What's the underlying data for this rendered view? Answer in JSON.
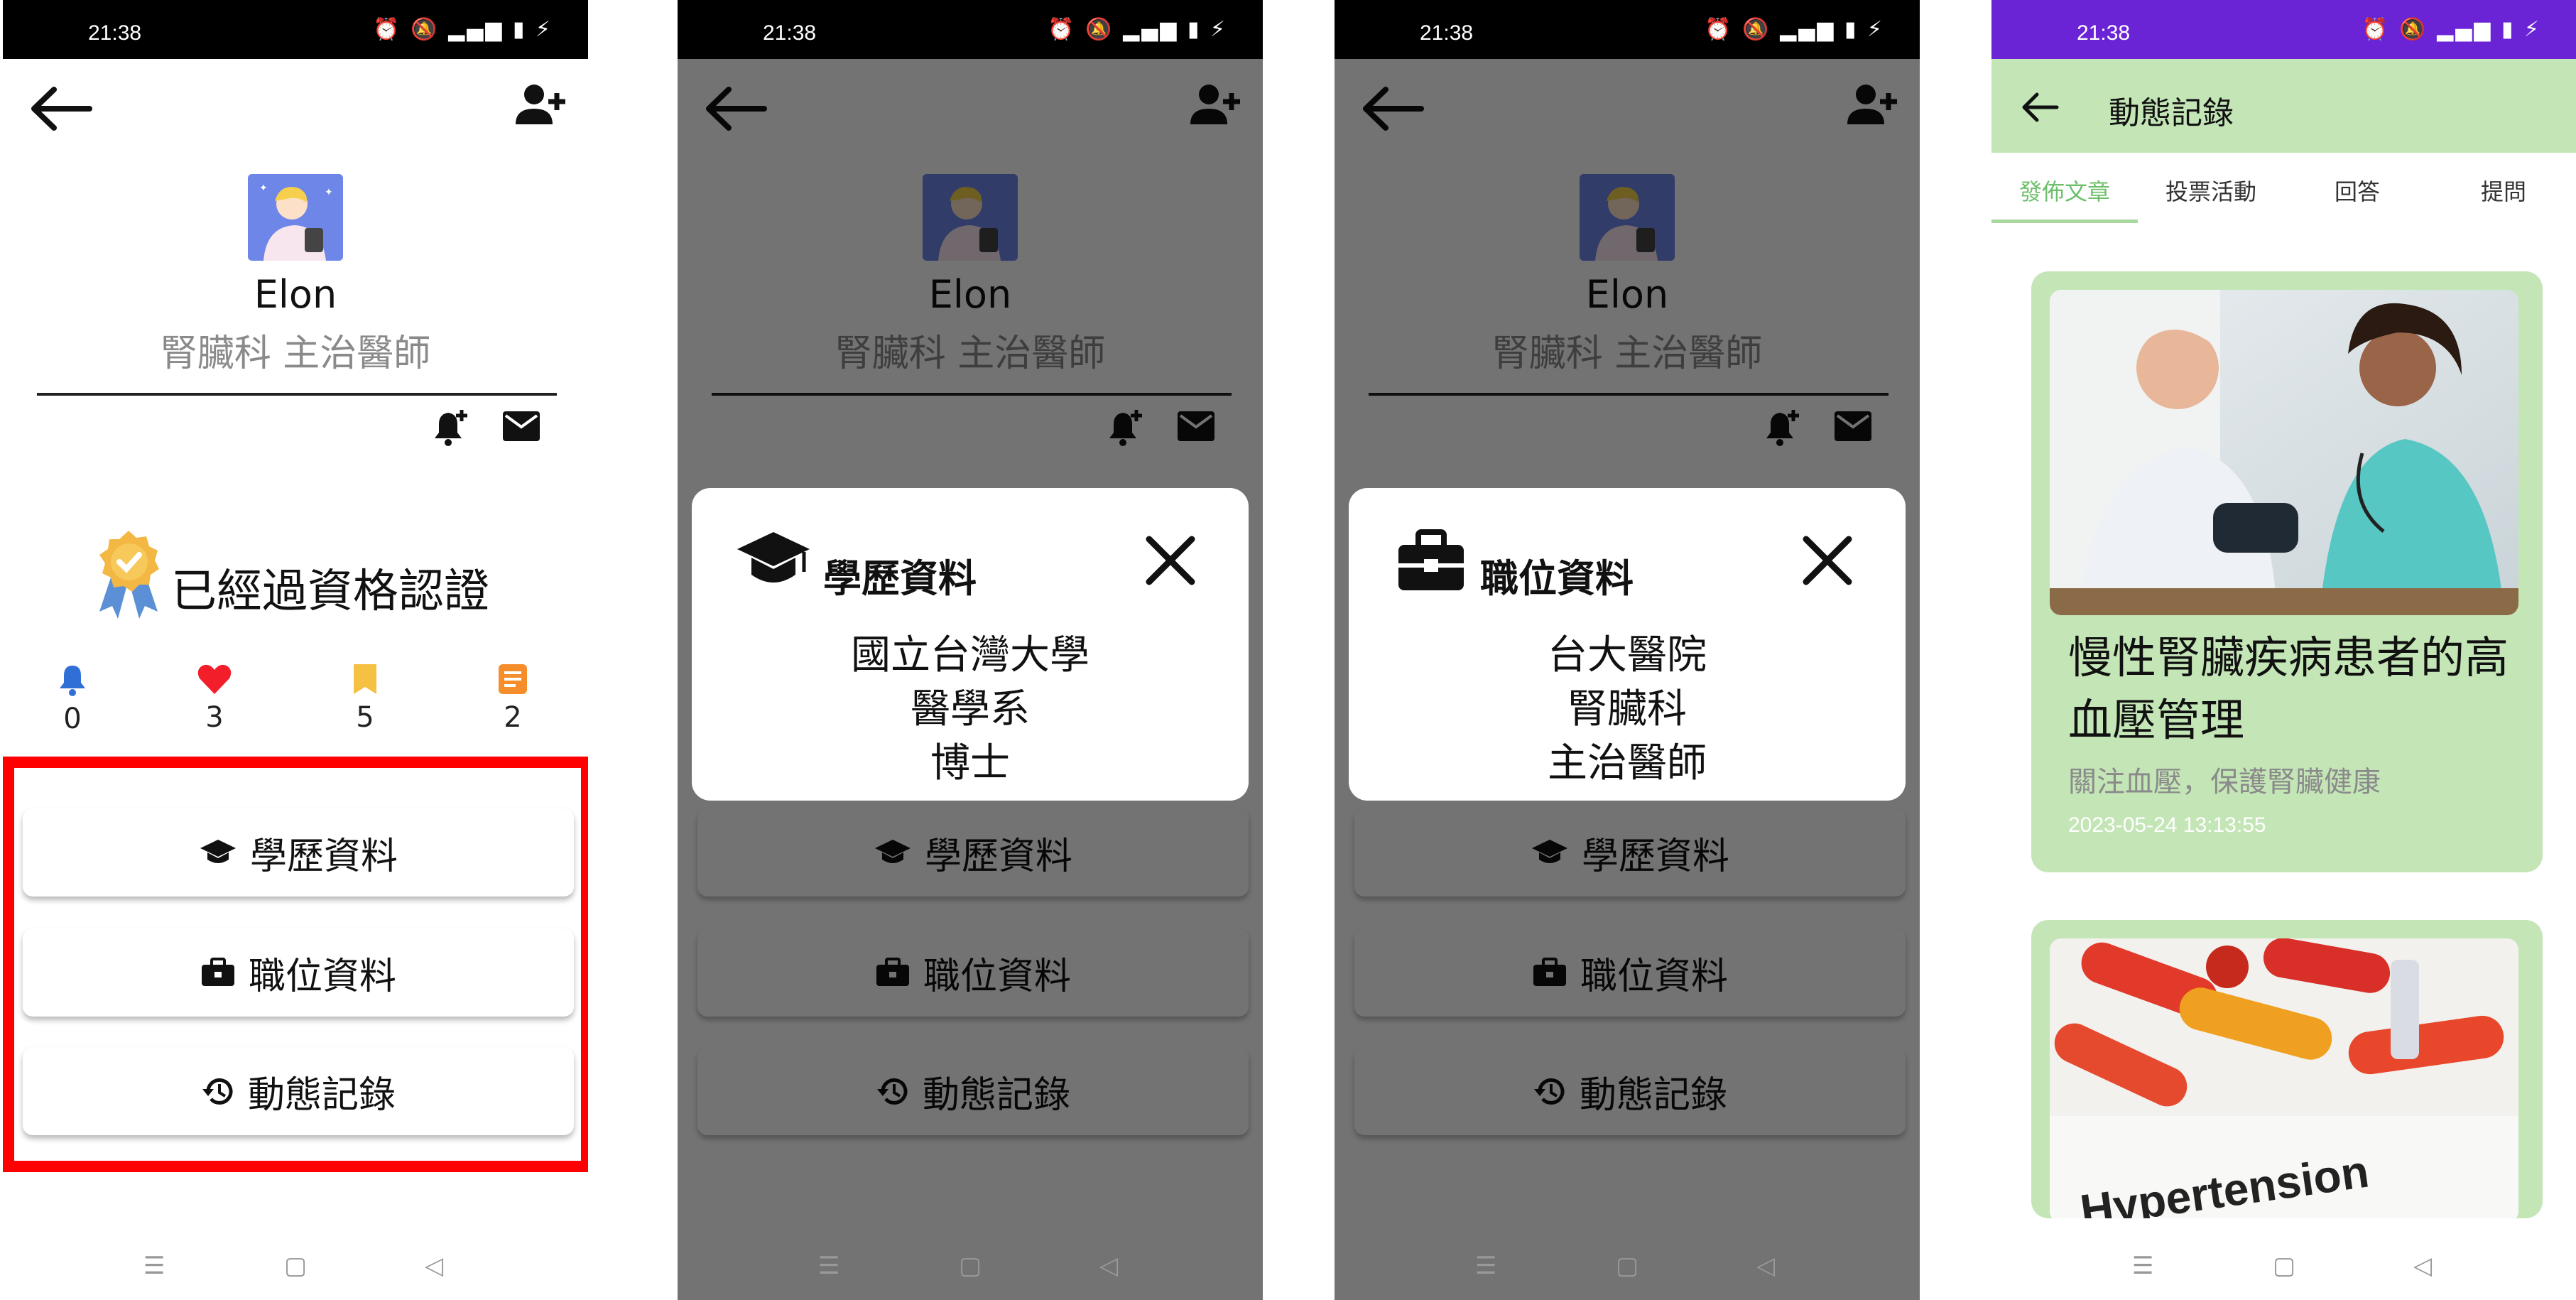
{
  "status_bar": {
    "time": "21:38",
    "icons": "⏰ 🔕 ▂▄▆ ▮ ⚡"
  },
  "profile": {
    "name": "Elon",
    "title": "腎臟科 主治醫師",
    "certification": "已經過資格認證",
    "stats": [
      {
        "icon": "bell-icon",
        "value": "0",
        "color": "#2f6fd6"
      },
      {
        "icon": "heart-icon",
        "value": "3",
        "color": "#f21f2a"
      },
      {
        "icon": "bookmark-icon",
        "value": "5",
        "color": "#f5c143"
      },
      {
        "icon": "note-icon",
        "value": "2",
        "color": "#f58d2a"
      }
    ],
    "buttons": {
      "education": "學歷資料",
      "position": "職位資料",
      "activity": "動態記錄"
    }
  },
  "education_dialog": {
    "title": "學歷資料",
    "lines": [
      "國立台灣大學",
      "醫學系",
      "博士"
    ]
  },
  "position_dialog": {
    "title": "職位資料",
    "lines": [
      "台大醫院",
      "腎臟科",
      "主治醫師"
    ]
  },
  "activity_page": {
    "title": "動態記錄",
    "tabs": [
      "發佈文章",
      "投票活動",
      "回答",
      "提問"
    ],
    "active_tab": "發佈文章",
    "posts": [
      {
        "title": "慢性腎臟疾病患者的高血壓管理",
        "subtitle": "關注血壓，保護腎臟健康",
        "date": "2023-05-24 13:13:55"
      },
      {
        "image_text": "Hypertension"
      }
    ]
  },
  "colors": {
    "highlight": "#ff0000",
    "appbar": "#c4e6b7",
    "accent": "#6dbf6a",
    "status_purple": "#6a24d6"
  }
}
